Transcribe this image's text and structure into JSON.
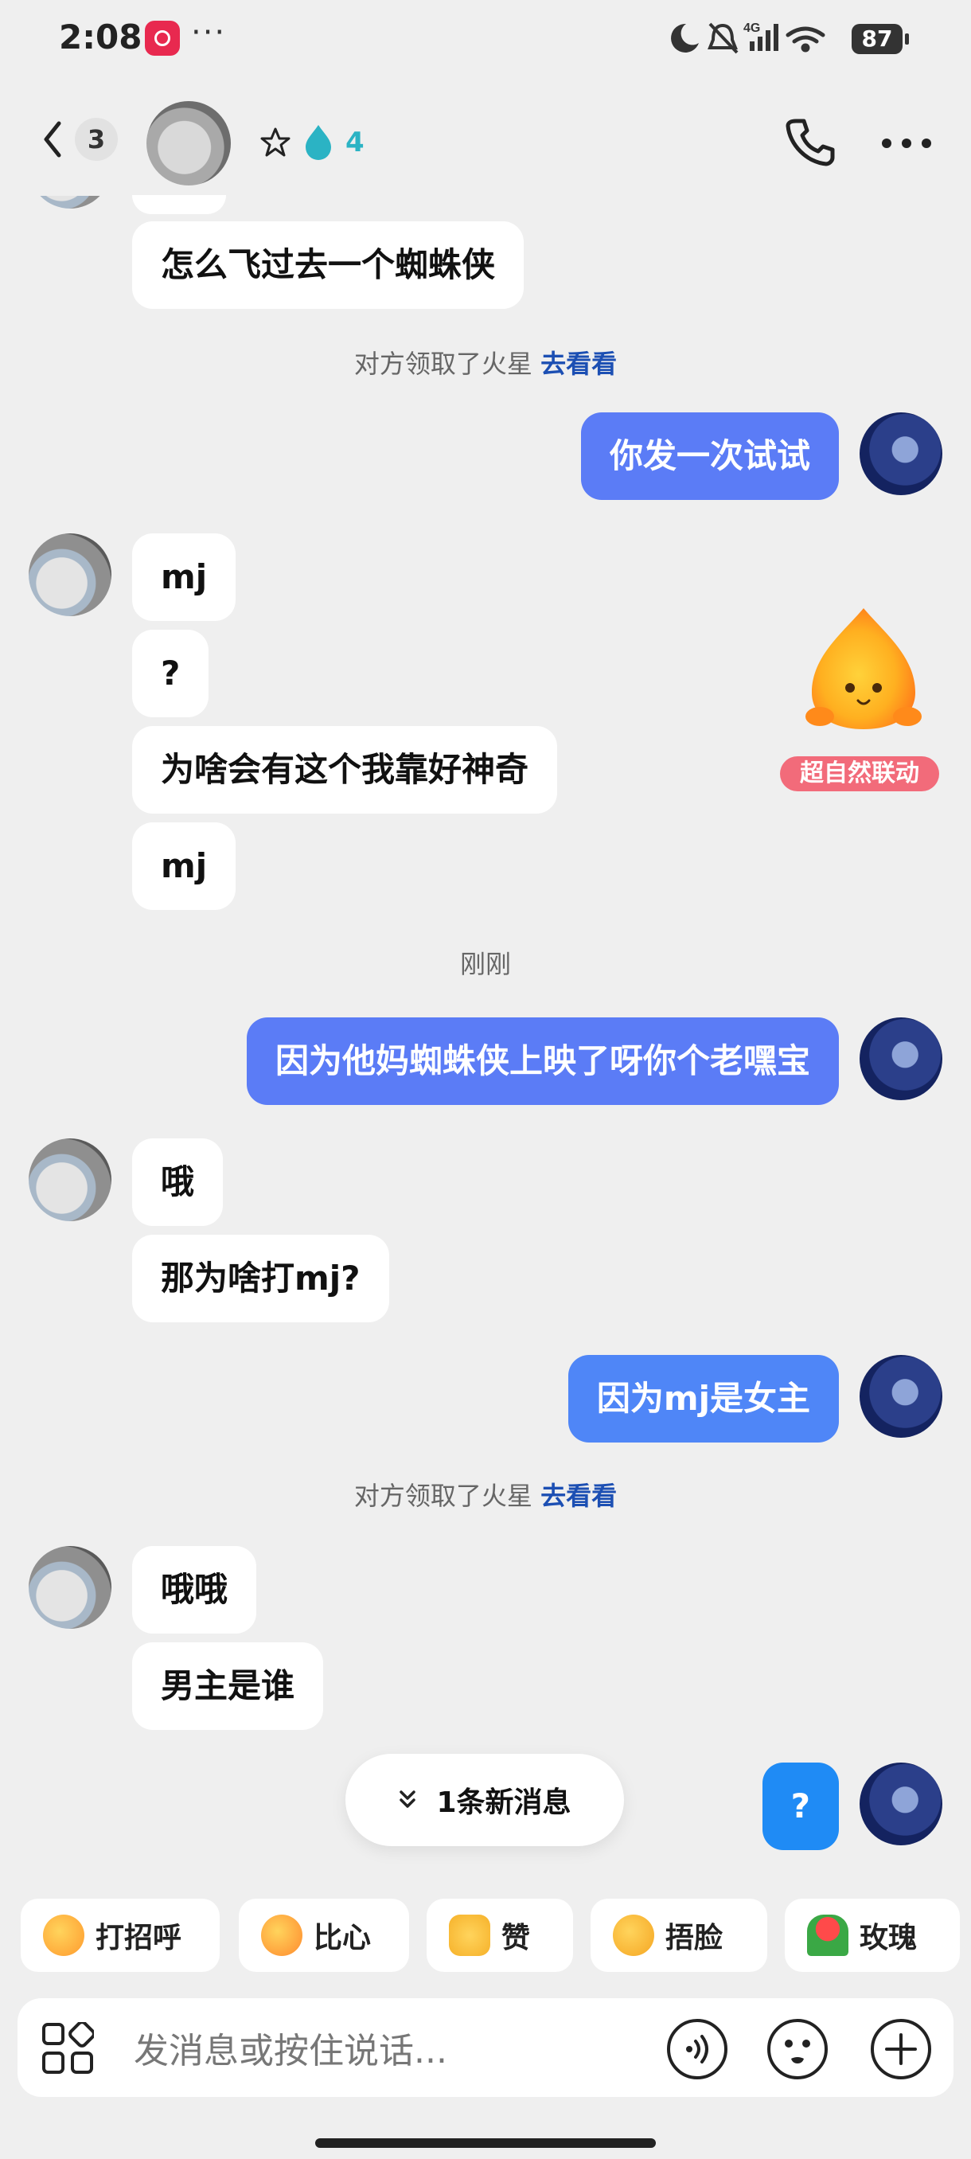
{
  "status_bar": {
    "time": "2:08",
    "more": "···",
    "network": "4G",
    "battery": "87"
  },
  "header": {
    "back_count": "3",
    "flame_count": "4"
  },
  "messages": {
    "m1": "怎么飞过去一个蜘蛛侠",
    "sys1_text": "对方领取了火星",
    "sys1_link": "去看看",
    "m2": "你发一次试试",
    "m3": "mj",
    "m4": "?",
    "m5": "为啥会有这个我靠好神奇",
    "m6": "mj",
    "sticker_label": "超自然联动",
    "time1": "刚刚",
    "m7": "因为他妈蜘蛛侠上映了呀你个老嘿宝",
    "m8": "哦",
    "m9": "那为啥打mj?",
    "m10": "因为mj是女主",
    "sys2_text": "对方领取了火星",
    "sys2_link": "去看看",
    "m11": "哦哦",
    "m12": "男主是谁",
    "m13": "?"
  },
  "new_message_pill": "1条新消息",
  "quick_replies": [
    "打招呼",
    "比心",
    "赞",
    "捂脸",
    "玫瑰"
  ],
  "input": {
    "placeholder": "发消息或按住说话..."
  }
}
